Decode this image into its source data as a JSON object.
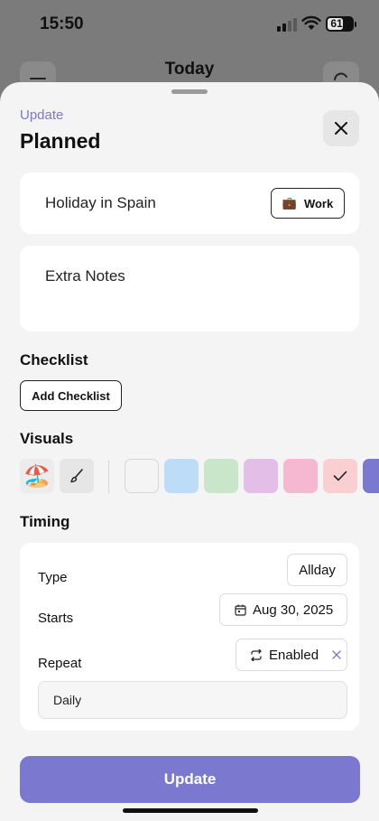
{
  "status_bar": {
    "time": "15:50",
    "battery": "61"
  },
  "background": {
    "title": "Today"
  },
  "sheet": {
    "kicker": "Update",
    "title": "Planned",
    "close_icon": "close-icon"
  },
  "task": {
    "name": "Holiday in Spain",
    "tag_emoji": "💼",
    "tag_label": "Work"
  },
  "notes": {
    "text": "Extra Notes"
  },
  "checklist": {
    "heading": "Checklist",
    "add_label": "Add Checklist"
  },
  "visuals": {
    "heading": "Visuals",
    "selected_emoji": "🏖️",
    "brush_icon": "brush-icon",
    "colors": [
      "#f4f4f4",
      "#bcdcf8",
      "#c9e6cb",
      "#e3bfe8",
      "#f6b8d1",
      "#f9cfd2",
      "#7b79cf"
    ],
    "selected_color_index": 5
  },
  "timing": {
    "heading": "Timing",
    "type_label": "Type",
    "type_value": "Allday",
    "starts_label": "Starts",
    "starts_value": "Aug 30, 2025",
    "repeat_label": "Repeat",
    "repeat_value": "Enabled",
    "frequency": "Daily"
  },
  "action": {
    "update_label": "Update"
  },
  "colors": {
    "accent": "#7b79cf",
    "sheet_bg": "#f4f4f4"
  }
}
